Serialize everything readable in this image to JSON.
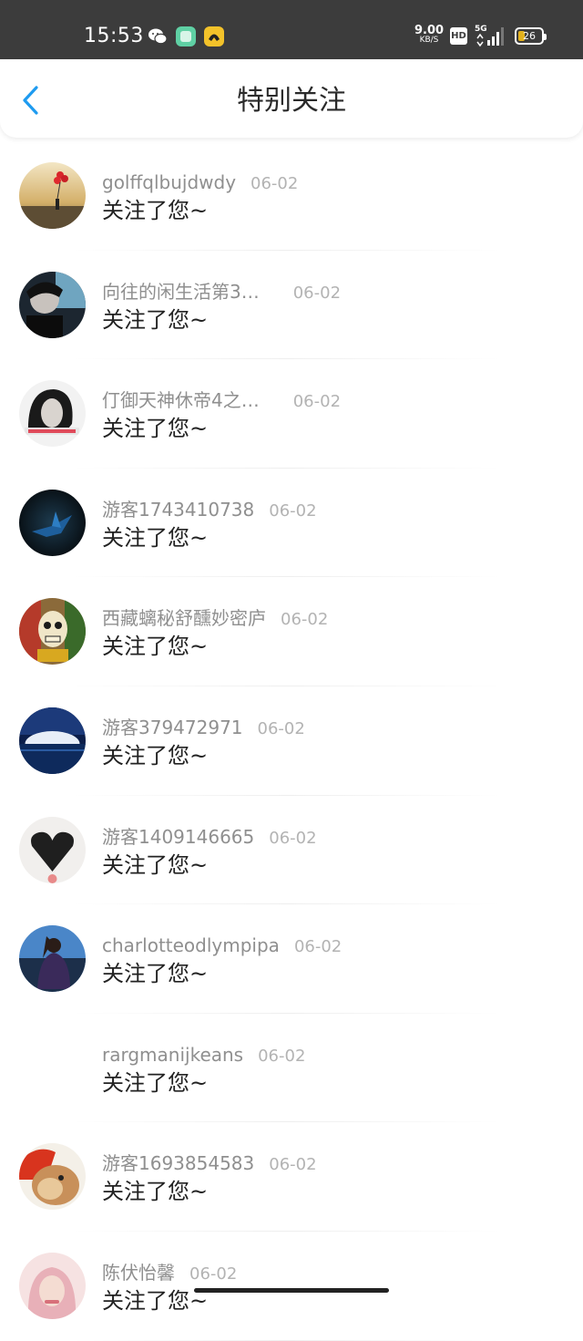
{
  "status_bar": {
    "time": "15:53",
    "speed_value": "9.00",
    "speed_unit": "KB/S",
    "hd": "HD",
    "network": "5G",
    "battery": "26"
  },
  "header": {
    "title": "特别关注"
  },
  "list": [
    {
      "name": "golffqlbujdwdy",
      "date": "06-02",
      "message": "关注了您~",
      "avatar": "red-balloon-sky"
    },
    {
      "name": "向往的闲生活第3…",
      "date": "06-02",
      "message": "关注了您~",
      "avatar": "dark-portrait"
    },
    {
      "name": "仃御天神休帝4之…",
      "date": "06-02",
      "message": "关注了您~",
      "avatar": "woman-bw"
    },
    {
      "name": "游客1743410738",
      "date": "06-02",
      "message": "关注了您~",
      "avatar": "paper-crane"
    },
    {
      "name": "西藏螭秘舒醺妙密庐",
      "date": "06-02",
      "message": "关注了您~",
      "avatar": "colorful-skull"
    },
    {
      "name": "游客379472971",
      "date": "06-02",
      "message": "关注了您~",
      "avatar": "moon-water"
    },
    {
      "name": "游客1409146665",
      "date": "06-02",
      "message": "关注了您~",
      "avatar": "black-heart"
    },
    {
      "name": "charlotteodlympipa",
      "date": "06-02",
      "message": "关注了您~",
      "avatar": "girl-lake"
    },
    {
      "name": "rargmanijkeans",
      "date": "06-02",
      "message": "关注了您~",
      "avatar": "none"
    },
    {
      "name": "游客1693854583",
      "date": "06-02",
      "message": "关注了您~",
      "avatar": "rabbit"
    },
    {
      "name": "陈伏怡馨",
      "date": "06-02",
      "message": "关注了您~",
      "avatar": "pink-girl"
    }
  ]
}
